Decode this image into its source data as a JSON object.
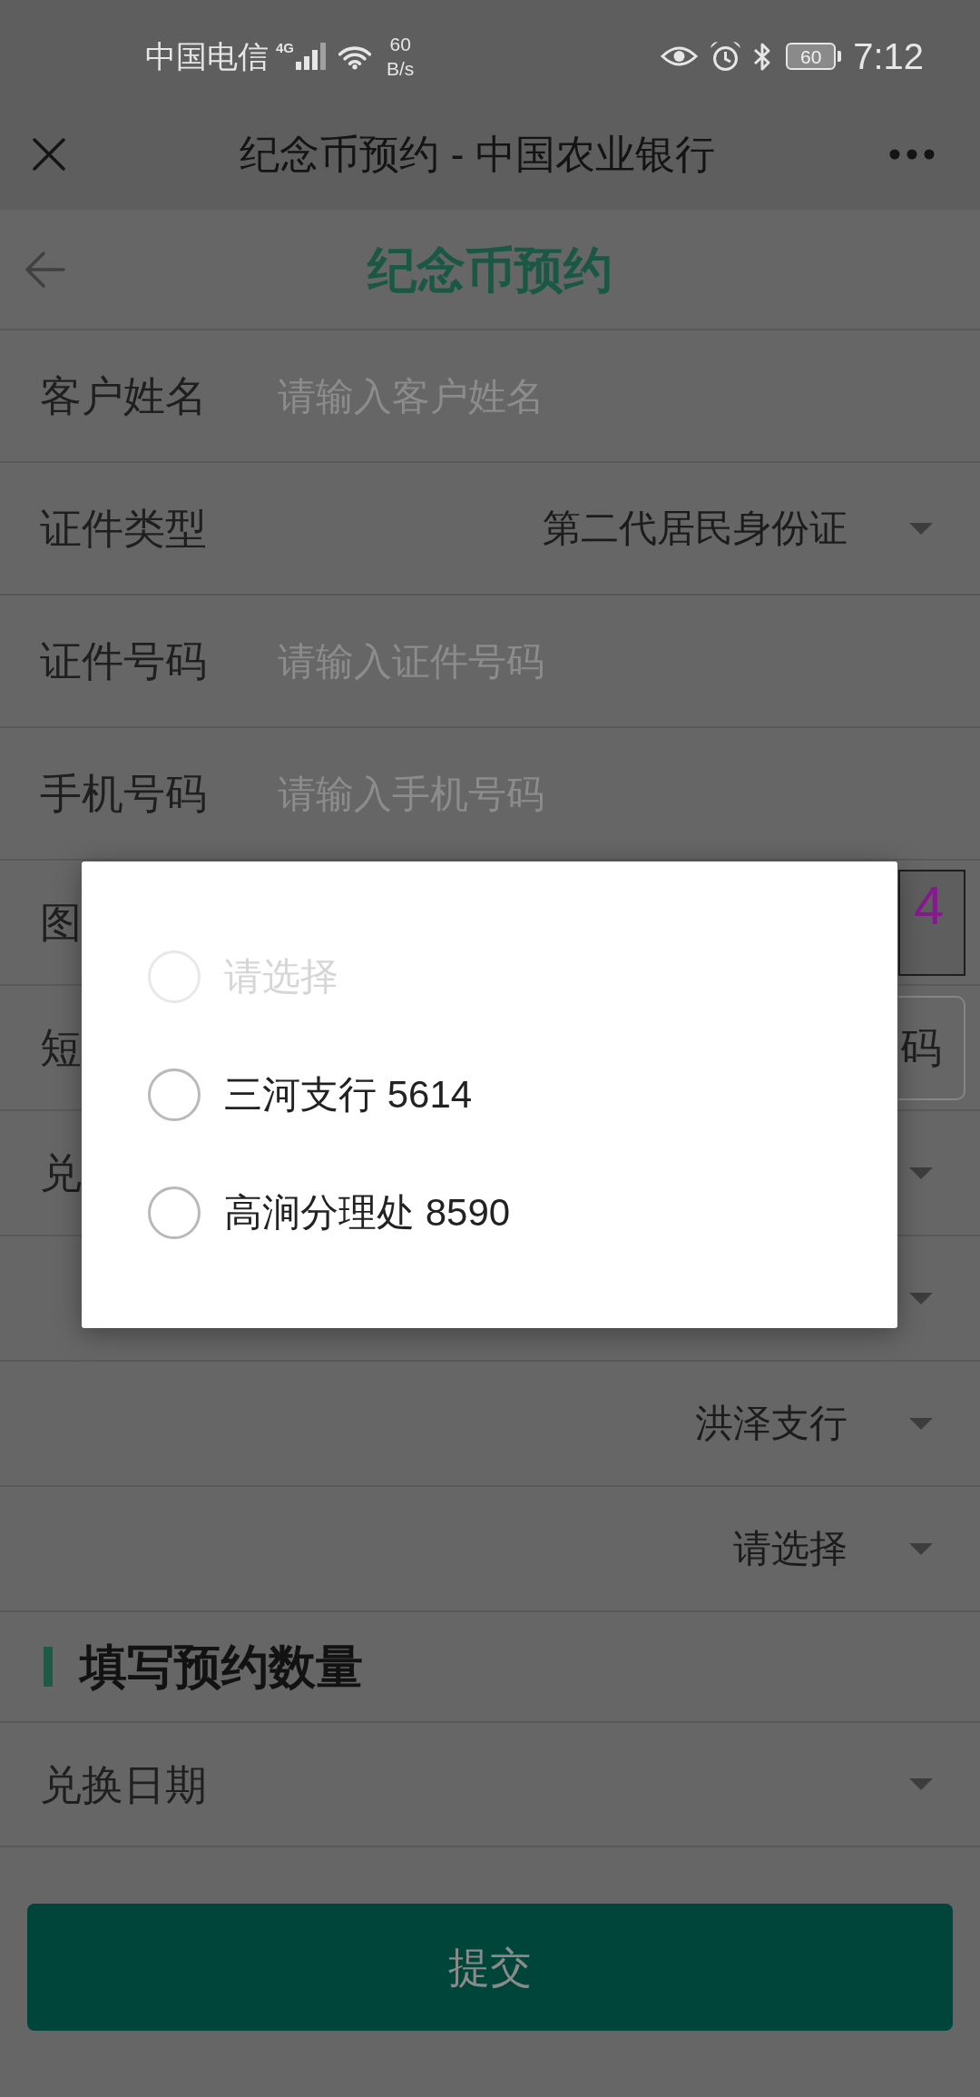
{
  "status_bar": {
    "carrier": "中国电信",
    "network": "4G",
    "speed": "60",
    "speed_unit": "B/s",
    "battery": "60",
    "time": "7:12"
  },
  "app_bar": {
    "title": "纪念币预约 - 中国农业银行"
  },
  "page_header": {
    "title": "纪念币预约"
  },
  "form_rows": [
    {
      "kind": "input",
      "label": "客户姓名",
      "placeholder": "请输入客户姓名"
    },
    {
      "kind": "select",
      "label": "证件类型",
      "value": "第二代居民身份证"
    },
    {
      "kind": "input",
      "label": "证件号码",
      "placeholder": "请输入证件号码"
    },
    {
      "kind": "input",
      "label": "手机号码",
      "placeholder": "请输入手机号码"
    },
    {
      "kind": "captcha",
      "label": "图",
      "captcha": "4"
    },
    {
      "kind": "sms",
      "label": "短",
      "button": "码"
    },
    {
      "kind": "select",
      "label": "兑"
    },
    {
      "kind": "select"
    },
    {
      "kind": "select",
      "value": "洪泽支行"
    },
    {
      "kind": "select",
      "value": "请选择"
    }
  ],
  "section": {
    "title": "填写预约数量",
    "rows": [
      {
        "kind": "select",
        "label": "兑换日期"
      }
    ]
  },
  "submit_button": {
    "label": "提交"
  },
  "dialog": {
    "options": [
      {
        "label": "请选择",
        "disabled": true,
        "selected": false
      },
      {
        "label": "三河支行 5614",
        "disabled": false,
        "selected": false
      },
      {
        "label": "高涧分理处 8590",
        "disabled": false,
        "selected": false
      }
    ]
  }
}
